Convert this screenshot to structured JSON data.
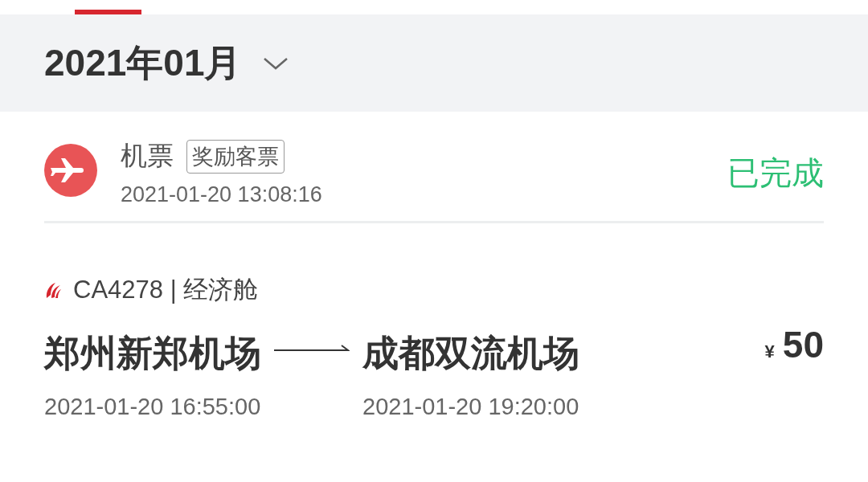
{
  "month_header": {
    "label": "2021年01月"
  },
  "order": {
    "category": "机票",
    "tag": "奖励客票",
    "created_time": "2021-01-20 13:08:16",
    "status": "已完成"
  },
  "flight": {
    "flight_info": "CA4278 | 经济舱",
    "departure": {
      "airport": "郑州新郑机场",
      "time": "2021-01-20 16:55:00"
    },
    "arrival": {
      "airport": "成都双流机场",
      "time": "2021-01-20 19:20:00"
    },
    "currency": "¥",
    "price": "50"
  }
}
